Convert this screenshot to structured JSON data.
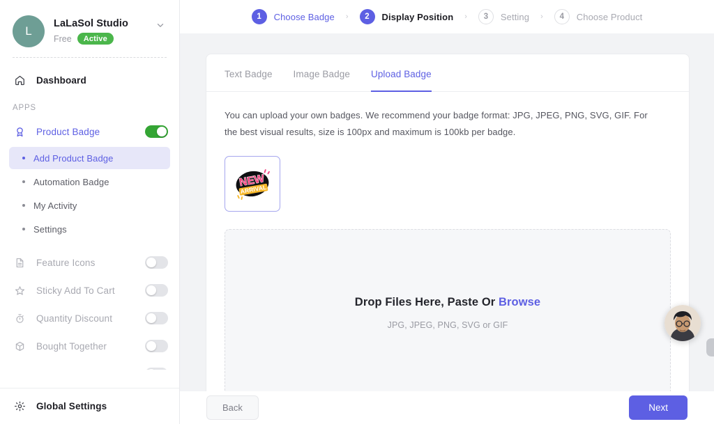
{
  "sidebar": {
    "store": {
      "avatar_initial": "L",
      "name": "LaLaSol Studio",
      "plan": "Free",
      "status": "Active",
      "chevron": "chevron-down-icon"
    },
    "dashboard": {
      "label": "Dashboard",
      "icon": "home-icon"
    },
    "section_label": "APPS",
    "product_badge": {
      "label": "Product Badge",
      "icon": "badge-icon",
      "toggle": "on"
    },
    "sub_items": [
      {
        "label": "Add Product Badge",
        "selected": true
      },
      {
        "label": "Automation Badge",
        "selected": false
      },
      {
        "label": "My Activity",
        "selected": false
      },
      {
        "label": "Settings",
        "selected": false
      }
    ],
    "apps": [
      {
        "label": "Feature Icons",
        "icon": "document-icon",
        "toggle": "off"
      },
      {
        "label": "Sticky Add To Cart",
        "icon": "pin-icon",
        "toggle": "off"
      },
      {
        "label": "Quantity Discount",
        "icon": "timer-icon",
        "toggle": "off"
      },
      {
        "label": "Bought Together",
        "icon": "box-icon",
        "toggle": "off"
      }
    ],
    "global_settings": {
      "label": "Global Settings",
      "icon": "gear-icon"
    }
  },
  "stepper": {
    "separator": "›",
    "steps": [
      {
        "num": "1",
        "label": "Choose Badge",
        "state": "done"
      },
      {
        "num": "2",
        "label": "Display Position",
        "state": "current"
      },
      {
        "num": "3",
        "label": "Setting",
        "state": "todo"
      },
      {
        "num": "4",
        "label": "Choose Product",
        "state": "todo"
      }
    ]
  },
  "card": {
    "tabs": [
      {
        "label": "Text Badge",
        "active": false
      },
      {
        "label": "Image Badge",
        "active": false
      },
      {
        "label": "Upload Badge",
        "active": true
      }
    ],
    "help_text": "You can upload your own badges. We recommend your badge format: JPG, JPEG, PNG, SVG, GIF. For the best visual results, size is 100px and maximum is 100kb per badge.",
    "badge_thumbnail": {
      "name": "new-arrival-badge",
      "line1": "NEW",
      "line2": "ARRIVAL"
    },
    "dropzone": {
      "main_prefix": "Drop Files Here, Paste Or ",
      "browse": "Browse",
      "formats": "JPG, JPEG, PNG, SVG or GIF"
    }
  },
  "footer": {
    "back": "Back",
    "next": "Next"
  },
  "widgets": {
    "chat_avatar": "support-agent-avatar",
    "edge_handle": "drawer-handle"
  },
  "colors": {
    "accent": "#5d5fe3",
    "accent_soft": "#e7e7f9",
    "toggle_on": "#34a534",
    "status_green": "#4bb64b",
    "page_bg": "#f2f3f5",
    "badge_pink": "#f0437f",
    "badge_yellow": "#f7b82a"
  }
}
